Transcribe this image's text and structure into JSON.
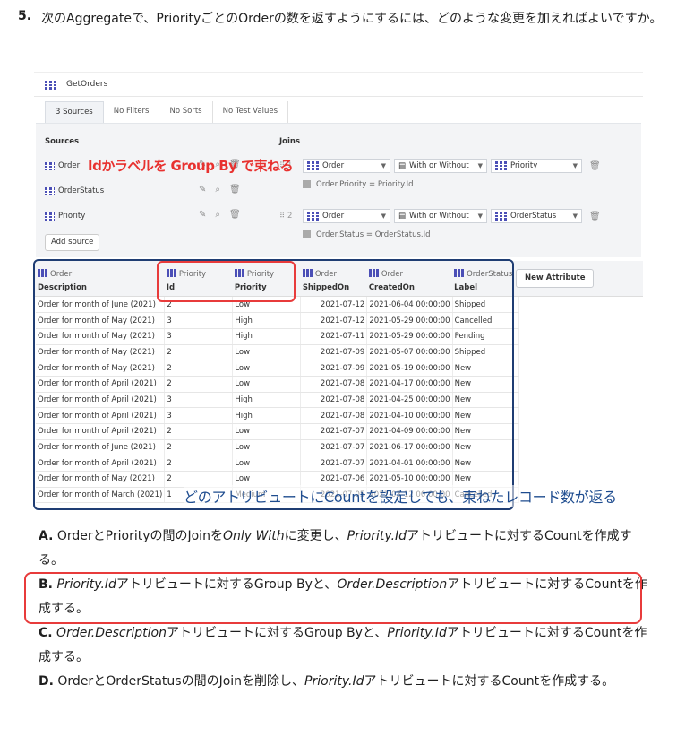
{
  "question": {
    "number": "5.",
    "text": "次のAggregateで、PriorityごとのOrderの数を返すようにするには、どのような変更を加えればよいですか。"
  },
  "aggregate": {
    "title": "GetOrders",
    "tabs": [
      "3 Sources",
      "No Filters",
      "No Sorts",
      "No Test Values"
    ],
    "sources_label": "Sources",
    "joins_label": "Joins",
    "sources": [
      "Order",
      "OrderStatus",
      "Priority"
    ],
    "add_source_label": "Add source",
    "joins": [
      {
        "num": "1",
        "left": "Order",
        "type": "With or Without",
        "right": "Priority",
        "condition": "Order.Priority = Priority.Id"
      },
      {
        "num": "2",
        "left": "Order",
        "type": "With or Without",
        "right": "OrderStatus",
        "condition": "Order.Status = OrderStatus.Id"
      }
    ],
    "new_attribute_label": "New Attribute",
    "columns": [
      {
        "entity": "Order",
        "attr": "Description"
      },
      {
        "entity": "Priority",
        "attr": "Id"
      },
      {
        "entity": "Priority",
        "attr": "Priority"
      },
      {
        "entity": "Order",
        "attr": "ShippedOn"
      },
      {
        "entity": "Order",
        "attr": "CreatedOn"
      },
      {
        "entity": "OrderStatus",
        "attr": "Label"
      }
    ],
    "rows": [
      [
        "Order for month of June (2021)",
        "2",
        "Low",
        "2021-07-12",
        "2021-06-04 00:00:00",
        "Shipped"
      ],
      [
        "Order for month of May (2021)",
        "3",
        "High",
        "2021-07-12",
        "2021-05-29 00:00:00",
        "Cancelled"
      ],
      [
        "Order for month of May (2021)",
        "3",
        "High",
        "2021-07-11",
        "2021-05-29 00:00:00",
        "Pending"
      ],
      [
        "Order for month of May (2021)",
        "2",
        "Low",
        "2021-07-09",
        "2021-05-07 00:00:00",
        "Shipped"
      ],
      [
        "Order for month of May (2021)",
        "2",
        "Low",
        "2021-07-09",
        "2021-05-19 00:00:00",
        "New"
      ],
      [
        "Order for month of April (2021)",
        "2",
        "Low",
        "2021-07-08",
        "2021-04-17 00:00:00",
        "New"
      ],
      [
        "Order for month of April (2021)",
        "3",
        "High",
        "2021-07-08",
        "2021-04-25 00:00:00",
        "New"
      ],
      [
        "Order for month of April (2021)",
        "3",
        "High",
        "2021-07-08",
        "2021-04-10 00:00:00",
        "New"
      ],
      [
        "Order for month of April (2021)",
        "2",
        "Low",
        "2021-07-07",
        "2021-04-09 00:00:00",
        "New"
      ],
      [
        "Order for month of June (2021)",
        "2",
        "Low",
        "2021-07-07",
        "2021-06-17 00:00:00",
        "New"
      ],
      [
        "Order for month of April (2021)",
        "2",
        "Low",
        "2021-07-07",
        "2021-04-01 00:00:00",
        "New"
      ],
      [
        "Order for month of May (2021)",
        "2",
        "Low",
        "2021-07-06",
        "2021-05-10 00:00:00",
        "New"
      ],
      [
        "Order for month of March (2021)",
        "1",
        "Medium",
        "2021-07-05",
        "2021-03-12 00:00:00",
        "Cancelled"
      ]
    ]
  },
  "annotations": {
    "red": "Idかラベルを Group By で束ねる",
    "blue": "どのアトリビュートにCountを設定しても、束ねたレコード数が返る"
  },
  "answers": {
    "a": {
      "letter": "A.",
      "p1": "OrderとPriorityの間のJoinを",
      "i1": "Only With",
      "p2": "に変更し、",
      "i2": "Priority.Id",
      "p3": "アトリビュートに対するCountを作成する。"
    },
    "b": {
      "letter": "B.",
      "i1": "Priority.Id",
      "p1": "アトリビュートに対するGroup Byと、",
      "i2": "Order.Description",
      "p2": "アトリビュートに対するCountを作成する。"
    },
    "c": {
      "letter": "C.",
      "i1": "Order.Description",
      "p1": "アトリビュートに対するGroup Byと、",
      "i2": "Priority.Id",
      "p2": "アトリビュートに対するCountを作成する。"
    },
    "d": {
      "letter": "D.",
      "p1": "OrderとOrderStatusの間のJoinを削除し、",
      "i1": "Priority.Id",
      "p2": "アトリビュートに対するCountを作成する。"
    }
  }
}
